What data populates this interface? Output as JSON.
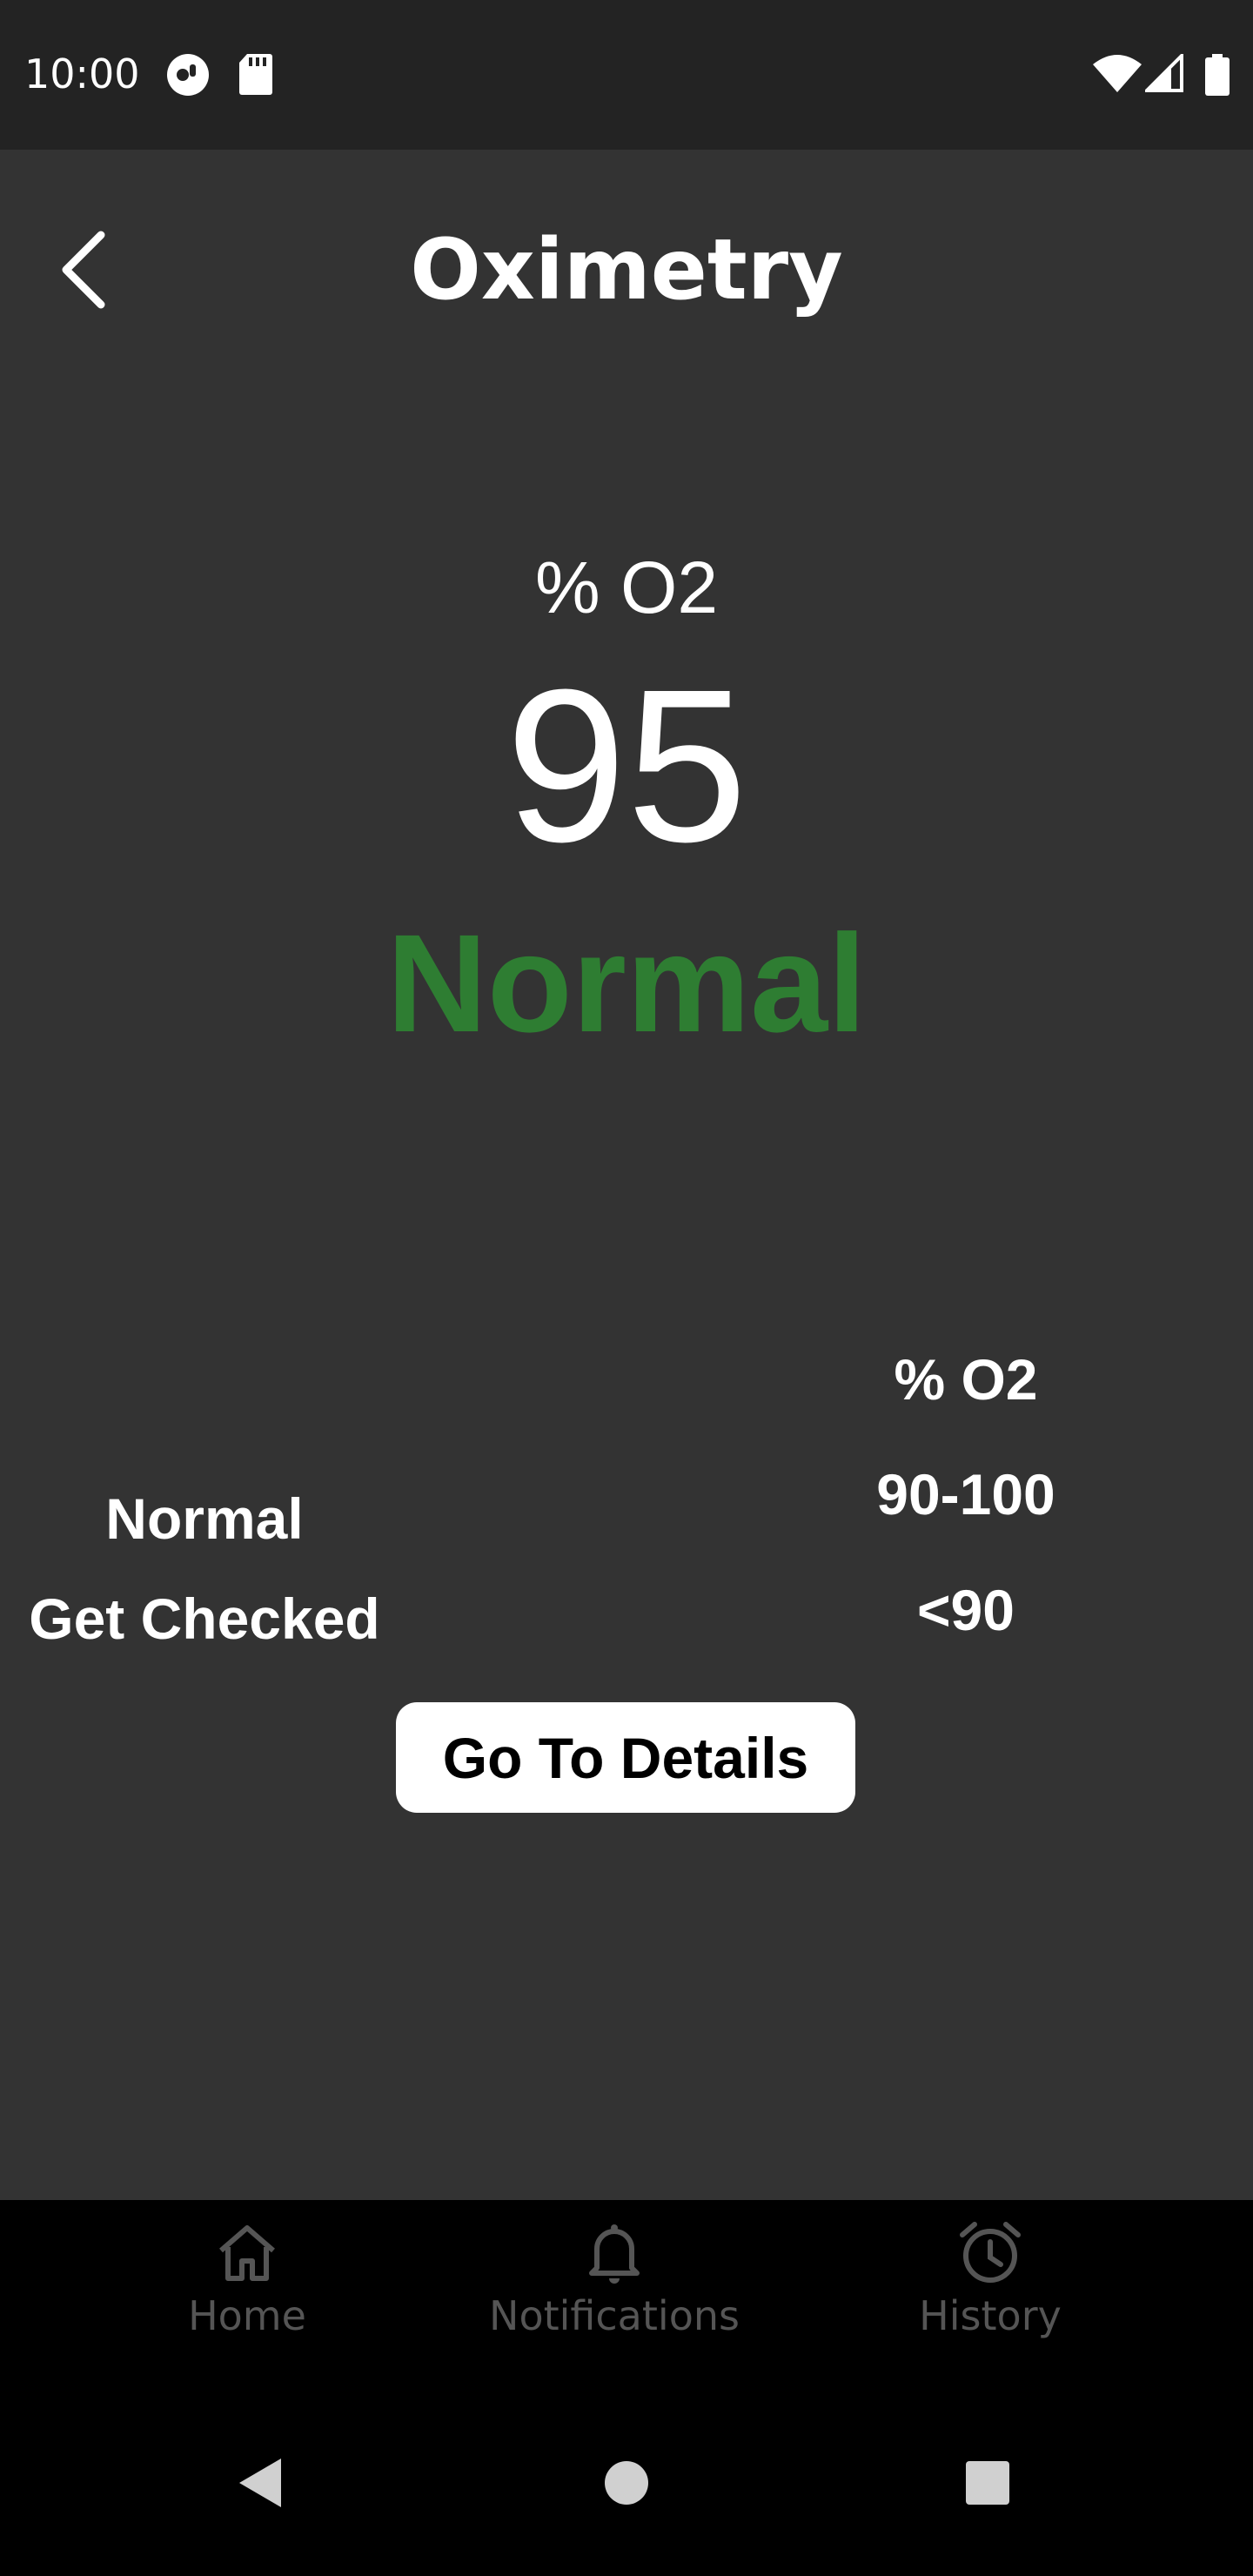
{
  "status_bar": {
    "time": "10:00",
    "left_icons": [
      "app-notification-icon",
      "sd-card-icon"
    ],
    "right_icons": [
      "wifi-icon",
      "cellular-signal-icon",
      "battery-icon"
    ]
  },
  "header": {
    "back_icon": "chevron-left-icon",
    "title": "Oximetry"
  },
  "reading": {
    "unit": "% O2",
    "value": "95",
    "status": "Normal",
    "status_color": "#2e7d32"
  },
  "reference_table": {
    "header": "% O2",
    "rows": [
      {
        "label": "Normal",
        "range": "90-100"
      },
      {
        "label": "Get Checked",
        "range": "<90"
      }
    ]
  },
  "actions": {
    "details_label": "Go To Details"
  },
  "bottom_nav": {
    "items": [
      {
        "label": "Home",
        "icon": "home-icon"
      },
      {
        "label": "Notifications",
        "icon": "bell-icon"
      },
      {
        "label": "History",
        "icon": "alarm-clock-icon"
      }
    ]
  },
  "system_nav": {
    "buttons": [
      "back-triangle-icon",
      "home-circle-icon",
      "recents-square-icon"
    ]
  }
}
